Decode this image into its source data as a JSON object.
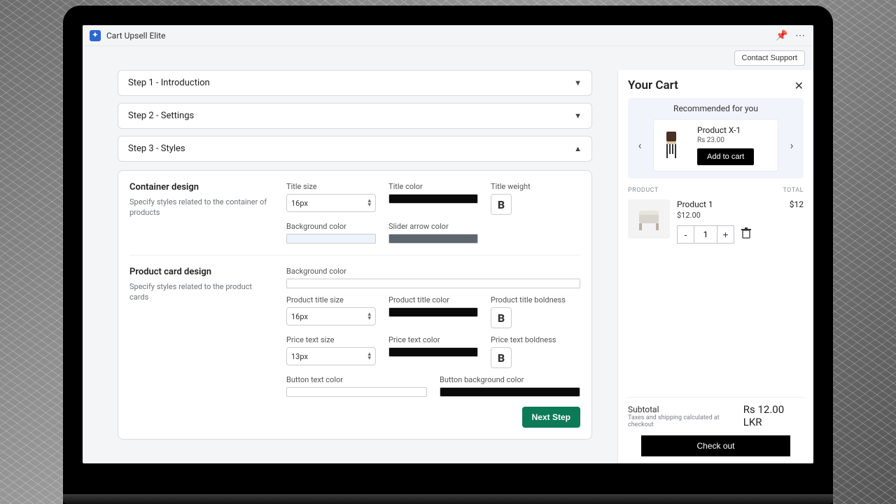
{
  "app": {
    "title": "Cart Upsell Elite"
  },
  "toolbar": {
    "contact_label": "Contact Support"
  },
  "steps": {
    "s1": "Step 1 - Introduction",
    "s2": "Step 2 - Settings",
    "s3": "Step 3 - Styles"
  },
  "container_design": {
    "heading": "Container design",
    "desc": "Specify styles related to the container of products",
    "title_size_label": "Title size",
    "title_size_value": "16px",
    "title_color_label": "Title color",
    "title_color_value": "#0a0a0a",
    "title_weight_label": "Title weight",
    "bg_label": "Background color",
    "bg_value": "#eef4fb",
    "slider_label": "Slider arrow color",
    "slider_value": "#5f666d"
  },
  "product_card": {
    "heading": "Product card design",
    "desc": "Specify styles related to the product cards",
    "bg_label": "Background color",
    "bg_value": "#ffffff",
    "ptitle_size_label": "Product title size",
    "ptitle_size_value": "16px",
    "ptitle_color_label": "Product title color",
    "ptitle_color_value": "#0a0a0a",
    "ptitle_bold_label": "Product title boldness",
    "price_size_label": "Price text size",
    "price_size_value": "13px",
    "price_color_label": "Price text color",
    "price_color_value": "#0a0a0a",
    "price_bold_label": "Price text boldness",
    "btn_text_color_label": "Button text color",
    "btn_text_color_value": "#ffffff",
    "btn_bg_label": "Button background color",
    "btn_bg_value": "#0a0a0a"
  },
  "next_label": "Next Step",
  "cart": {
    "title": "Your Cart",
    "reco_title": "Recommended for you",
    "reco_product": "Product X-1",
    "reco_price": "Rs 23.00",
    "atc_label": "Add to cart",
    "col_product": "PRODUCT",
    "col_total": "TOTAL",
    "item_name": "Product 1",
    "item_price": "$12.00",
    "item_total": "$12",
    "item_qty": "1",
    "subtotal_label": "Subtotal",
    "subtotal_note": "Taxes and shipping calculated at checkout",
    "subtotal_value": "Rs 12.00 LKR",
    "checkout_label": "Check out"
  }
}
